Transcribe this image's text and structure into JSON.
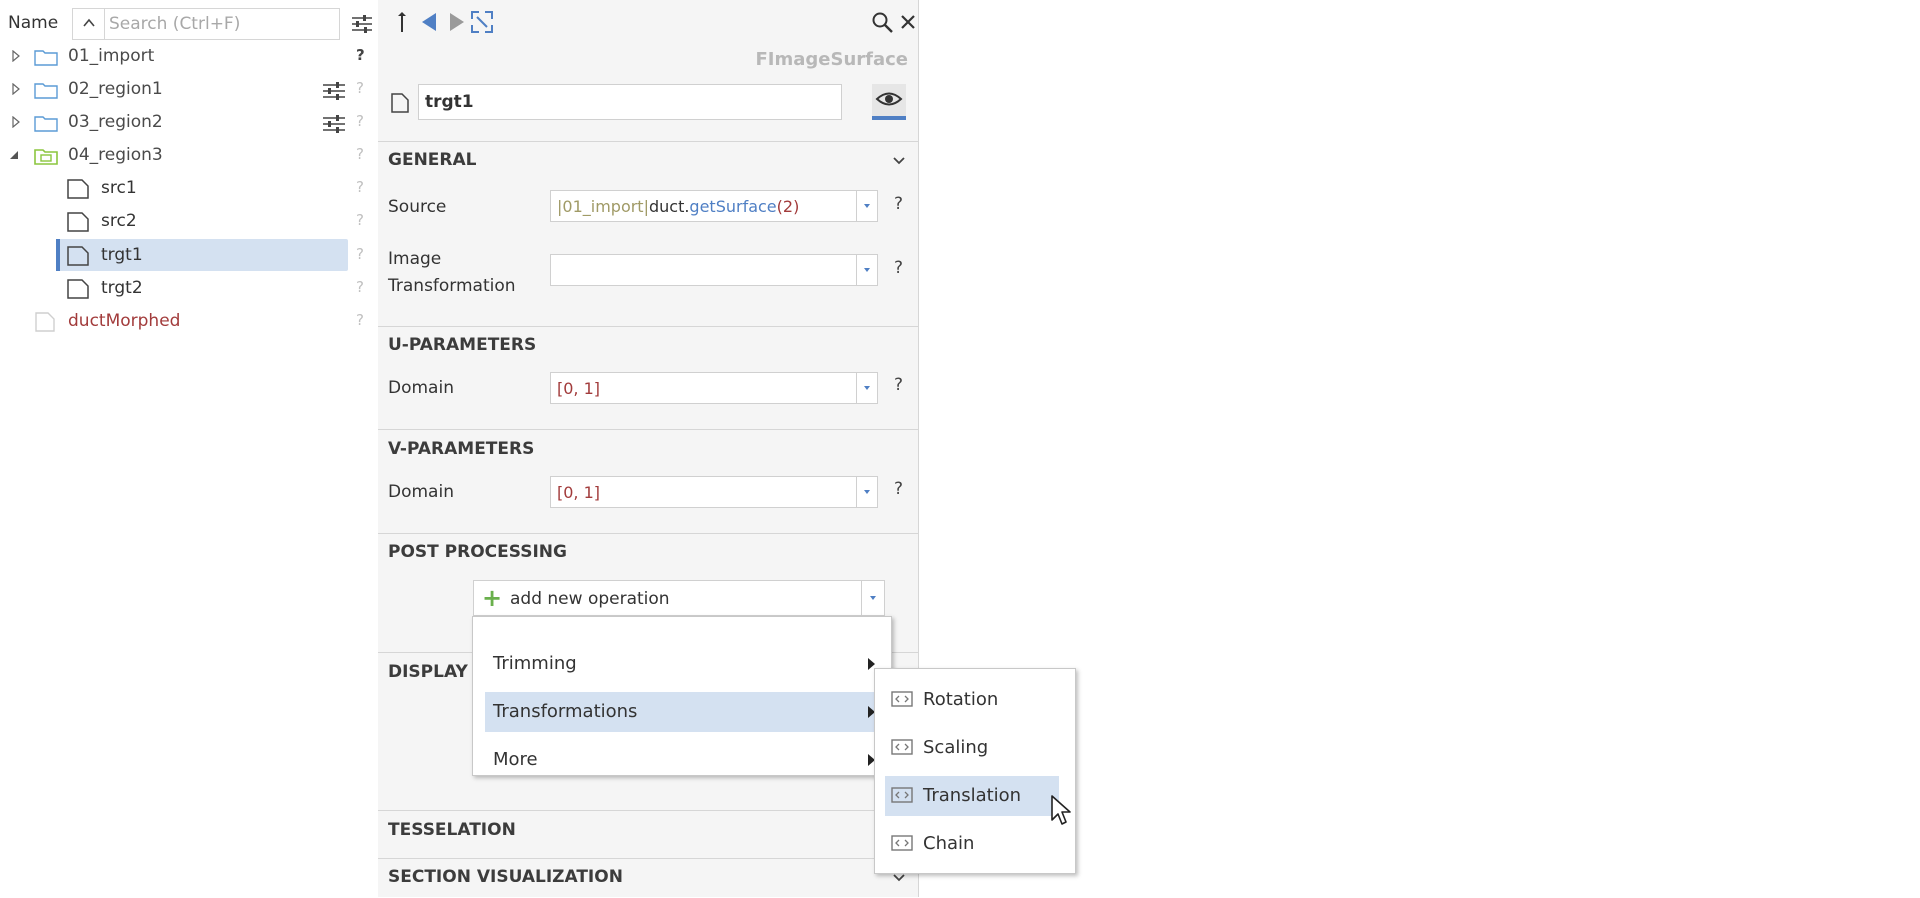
{
  "tree": {
    "header": {
      "name_label": "Name",
      "search_placeholder": "Search (Ctrl+F)"
    },
    "items": [
      {
        "label": "01_import",
        "type": "folder",
        "help": "?"
      },
      {
        "label": "02_region1",
        "type": "folder",
        "help": "?"
      },
      {
        "label": "03_region2",
        "type": "folder",
        "help": "?"
      },
      {
        "label": "04_region3",
        "type": "folder-active",
        "help": "?"
      },
      {
        "label": "src1",
        "type": "file",
        "help": "?"
      },
      {
        "label": "src2",
        "type": "file",
        "help": "?"
      },
      {
        "label": "trgt1",
        "type": "file",
        "help": "?",
        "selected": true
      },
      {
        "label": "trgt2",
        "type": "file",
        "help": "?"
      },
      {
        "label": "ductMorphed",
        "type": "file-red",
        "help": "?"
      }
    ]
  },
  "props": {
    "type_label": "FImageSurface",
    "name_value": "trgt1",
    "general": {
      "title": "GENERAL",
      "source_label": "Source",
      "source_value": {
        "part1": "|01_import|",
        "part2": "duct.",
        "part3": "getSurface",
        "part4": "(2)"
      },
      "image_transformation_label": "Image Transformation",
      "image_transformation_value": ""
    },
    "u_params": {
      "title": "U-PARAMETERS",
      "domain_label": "Domain",
      "domain_value": "[0, 1]"
    },
    "v_params": {
      "title": "V-PARAMETERS",
      "domain_label": "Domain",
      "domain_value": "[0, 1]"
    },
    "post_processing": {
      "title": "POST PROCESSING",
      "add_label": "add new operation"
    },
    "display": {
      "title": "DISPLAY"
    },
    "tesselation": {
      "title": "TESSELATION"
    },
    "section_vis": {
      "title": "SECTION VISUALIZATION"
    },
    "help": "?"
  },
  "menu": {
    "items": [
      {
        "label": "Trimming"
      },
      {
        "label": "Transformations"
      },
      {
        "label": "More"
      }
    ]
  },
  "submenu": {
    "items": [
      {
        "label": "Rotation"
      },
      {
        "label": "Scaling"
      },
      {
        "label": "Translation"
      },
      {
        "label": "Chain"
      }
    ]
  },
  "colors": {
    "accent": "#4f7fc4",
    "selection": "#d4e1f1",
    "error_red": "#a23b3b",
    "folder_active": "#8cc63f"
  }
}
